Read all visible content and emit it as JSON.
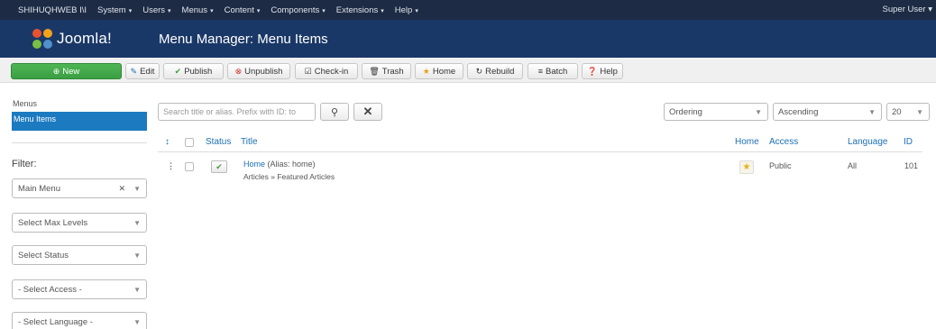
{
  "topnav": {
    "site": "SHIHUQHWEB I\\I",
    "menus": [
      "System",
      "Users",
      "Menus",
      "Content",
      "Components",
      "Extensions",
      "Help"
    ],
    "user": "Super User"
  },
  "header": {
    "logo_text": "Joomla!",
    "title": "Menu Manager: Menu Items"
  },
  "toolbar": {
    "new": "New",
    "edit": "Edit",
    "publish": "Publish",
    "unpublish": "Unpublish",
    "checkin": "Check-in",
    "trash": "Trash",
    "home": "Home",
    "rebuild": "Rebuild",
    "batch": "Batch",
    "help": "Help"
  },
  "sidebar": {
    "links": [
      "Menus",
      "Menu Items"
    ],
    "filter_label": "Filter:",
    "menu_select": "Main Menu",
    "max_levels": "Select Max Levels",
    "status": "Select Status",
    "access": "- Select Access -",
    "language": "- Select Language -"
  },
  "search": {
    "placeholder": "Search title or alias. Prefix with ID: to"
  },
  "ordering": {
    "field": "Ordering",
    "direction": "Ascending",
    "limit": "20"
  },
  "table": {
    "headers": {
      "sort": "↕",
      "status": "Status",
      "title": "Title",
      "home": "Home",
      "access": "Access",
      "language": "Language",
      "id": "ID"
    },
    "rows": [
      {
        "title": "Home",
        "alias": "(Alias: home)",
        "type": "Articles » Featured Articles",
        "access": "Public",
        "language": "All",
        "id": "101"
      }
    ]
  },
  "colors": {
    "topnav_bg": "#1d2b45",
    "header_bg": "#1a3867",
    "new_button": "#3b9f43",
    "active_link": "#1b7ac0",
    "link": "#1b6fb5"
  }
}
